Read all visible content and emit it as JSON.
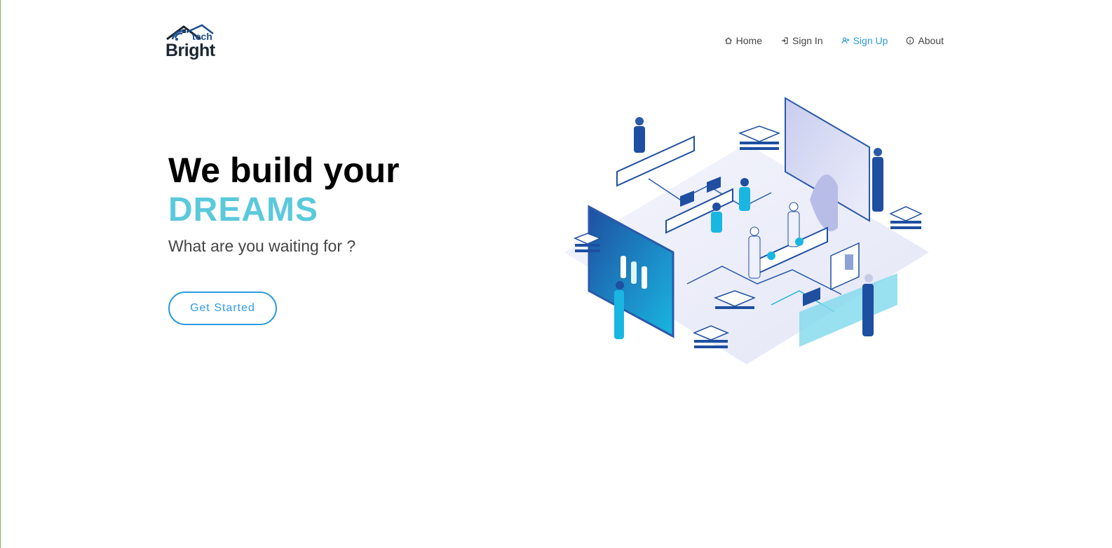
{
  "brand": {
    "word": "Bright",
    "tech": "tech"
  },
  "nav": {
    "items": [
      {
        "icon": "home-icon",
        "label": "Home"
      },
      {
        "icon": "sign-in-icon",
        "label": "Sign In"
      },
      {
        "icon": "user-plus-icon",
        "label": "Sign Up",
        "active": true
      },
      {
        "icon": "info-icon",
        "label": "About"
      }
    ]
  },
  "hero": {
    "title": "We build your",
    "accent": "DREAMS",
    "subtitle": "What are you waiting for ?",
    "cta_label": "Get Started"
  },
  "colors": {
    "accent": "#5bc9dc",
    "link_active": "#2e9be0",
    "text": "#444444"
  }
}
